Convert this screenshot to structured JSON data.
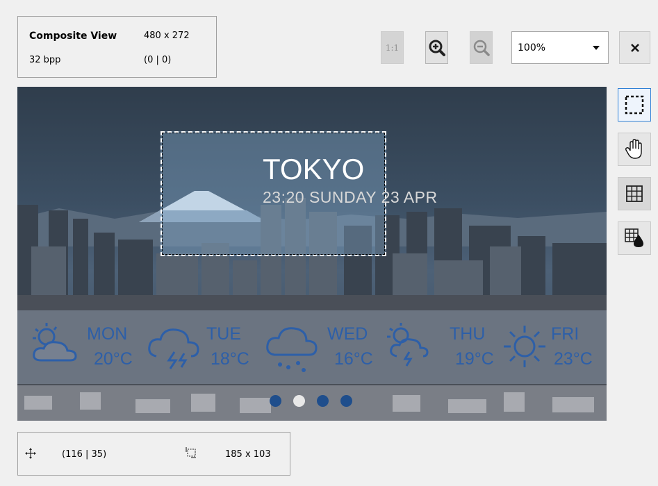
{
  "info": {
    "title": "Composite View",
    "dimensions": "480 x 272",
    "depth": "32 bpp",
    "coords": "(0 | 0)"
  },
  "toolbar": {
    "actual_size_label": "1:1",
    "zoom_value": "100%",
    "icons": [
      "zoom-in-icon",
      "zoom-out-icon",
      "close-icon",
      "chevron-down-icon"
    ]
  },
  "canvas": {
    "city": "TOKYO",
    "datetime": "23:20 SUNDAY 23 APR",
    "forecast": [
      {
        "day": "MON",
        "temp": "20°C",
        "icon": "partly-cloudy-icon"
      },
      {
        "day": "TUE",
        "temp": "18°C",
        "icon": "thunderstorm-icon"
      },
      {
        "day": "WED",
        "temp": "16°C",
        "icon": "rain-icon"
      },
      {
        "day": "THU",
        "temp": "19°C",
        "icon": "sun-thunderstorm-icon"
      },
      {
        "day": "FRI",
        "temp": "23°C",
        "icon": "sunny-icon"
      }
    ],
    "page_dots": 4,
    "active_dot": 1,
    "accent_color": "#2d5fa8"
  },
  "side_tools": [
    {
      "name": "selection-tool",
      "state": "active"
    },
    {
      "name": "pan-tool",
      "state": "normal"
    },
    {
      "name": "grid-tool",
      "state": "inactive"
    },
    {
      "name": "grid-fill-tool",
      "state": "normal"
    }
  ],
  "status": {
    "position": "(116 | 35)",
    "size": "185 x 103"
  }
}
